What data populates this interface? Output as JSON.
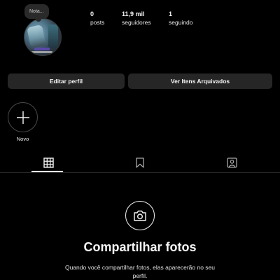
{
  "profile": {
    "note_placeholder": "Nota...",
    "stats": {
      "posts_count": "0",
      "posts_label": "posts",
      "followers_count": "11,9 mil",
      "followers_label": "seguidores",
      "following_count": "1",
      "following_label": "seguindo"
    }
  },
  "actions": {
    "edit_profile_label": "Editar perfil",
    "view_archive_label": "Ver Itens Arquivados"
  },
  "highlights": {
    "new_label": "Novo"
  },
  "tabs": [
    {
      "icon": "grid-icon",
      "active": true
    },
    {
      "icon": "bookmark-icon",
      "active": false
    },
    {
      "icon": "tagged-person-icon",
      "active": false
    }
  ],
  "empty_state": {
    "icon": "camera-icon",
    "title": "Compartilhar fotos",
    "description": "Quando você compartilhar fotos, elas aparecerão no seu perfil."
  },
  "colors": {
    "background": "#000000",
    "button_bg": "#262626",
    "text": "#f5f5f5"
  }
}
